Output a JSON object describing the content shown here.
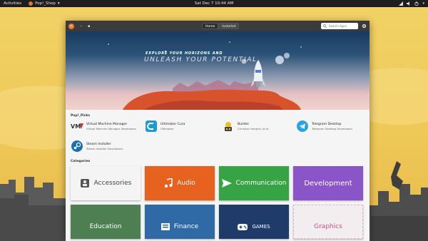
{
  "topbar": {
    "activities": "Activities",
    "app_menu": "Pop!_Shop",
    "clock": "Sat Dec 7  10:44 AM"
  },
  "window": {
    "tabs": [
      "Home",
      "Installed"
    ],
    "active_tab": "Home",
    "search_placeholder": "Search Apps"
  },
  "banner": {
    "kicker": "EXPLORE YOUR HORIZONS AND",
    "headline": "UNLEASH YOUR POTENTIAL"
  },
  "picks": {
    "title": "Pop!_Picks",
    "items": [
      {
        "name": "Virtual Machine Manager",
        "developer": "Virtual Machine Manager Developers",
        "icon": "vmm-icon"
      },
      {
        "name": "Ultimaker Cura",
        "developer": "Ultimaker",
        "icon": "cura-icon"
      },
      {
        "name": "Builder",
        "developer": "Christian Hergert, et al.",
        "icon": "builder-icon"
      },
      {
        "name": "Telegram Desktop",
        "developer": "Telegram Desktop Developers",
        "icon": "telegram-icon"
      },
      {
        "name": "Steam Installer",
        "developer": "Steam Installer Developers",
        "icon": "steam-icon"
      }
    ]
  },
  "categories": {
    "title": "Categories",
    "items": [
      {
        "label": "Accessories",
        "color": "#f4f4f4",
        "icon": "accessories-icon"
      },
      {
        "label": "Audio",
        "color": "#e8621f",
        "icon": "audio-icon"
      },
      {
        "label": "Communication",
        "color": "#36a345",
        "icon": "communication-icon"
      },
      {
        "label": "Development",
        "color": "#8a55c9",
        "icon": "development-icon"
      },
      {
        "label": "Education",
        "color": "#4d7f52",
        "icon": "education-icon"
      },
      {
        "label": "Finance",
        "color": "#2f6aa6",
        "icon": "finance-icon"
      },
      {
        "label": "GAMES",
        "color": "#1f3b6a",
        "icon": "games-icon"
      },
      {
        "label": "Graphics",
        "color": "#f2eef0",
        "icon": "graphics-icon"
      }
    ]
  }
}
